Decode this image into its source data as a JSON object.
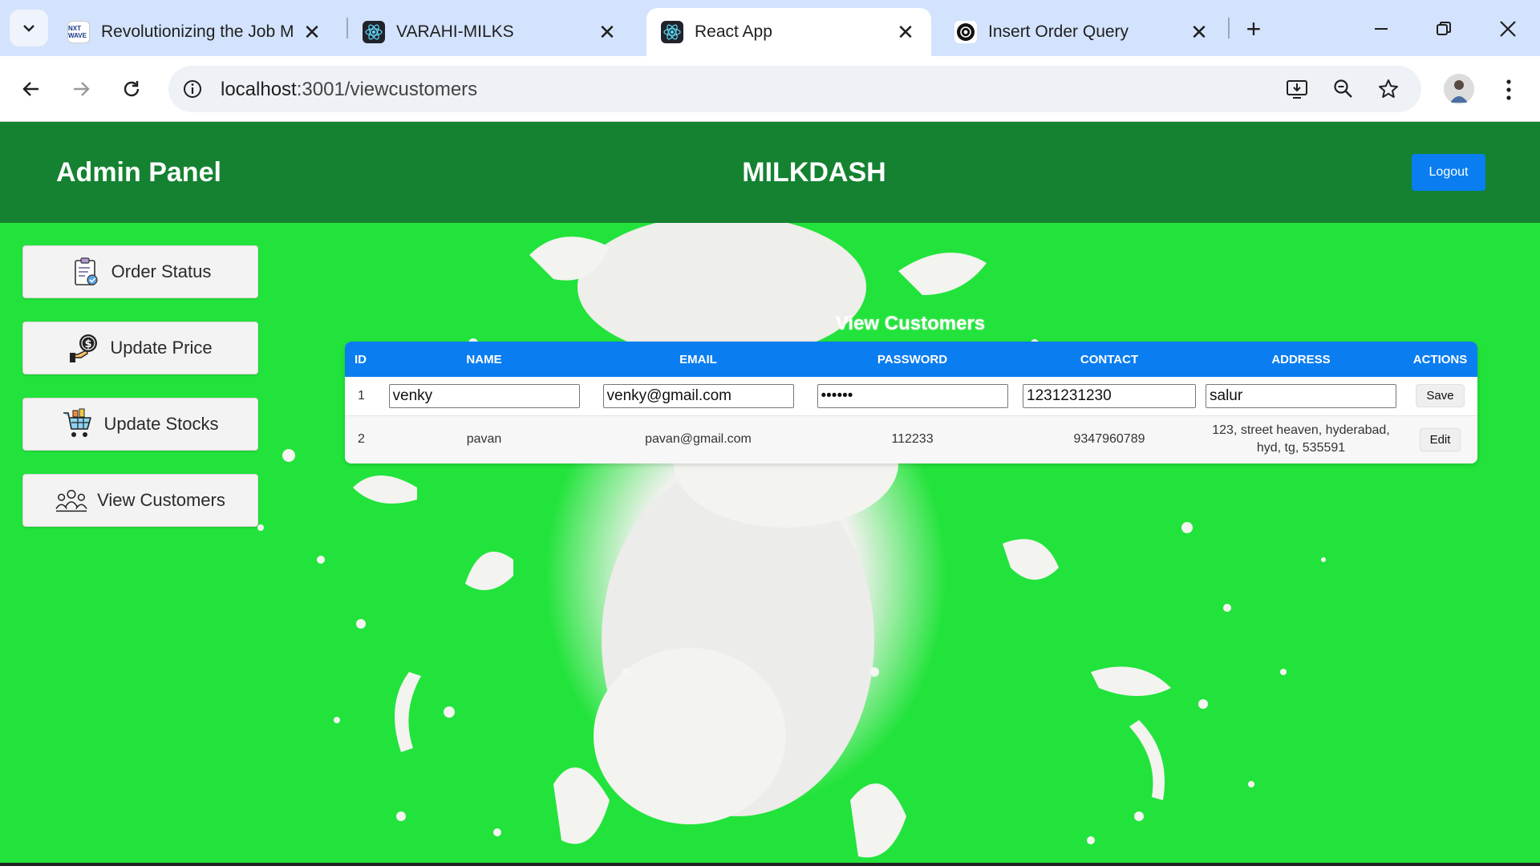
{
  "browser": {
    "tabs": [
      {
        "title": "Revolutionizing the Job M",
        "favicon": "nxtwave-favicon"
      },
      {
        "title": "VARAHI-MILKS",
        "favicon": "react-favicon"
      },
      {
        "title": "React App",
        "favicon": "react-favicon",
        "active": true
      },
      {
        "title": "Insert Order Query",
        "favicon": "chatgpt-favicon"
      }
    ],
    "favicon_text": "NXT WAVE",
    "url_host": "localhost",
    "url_path": ":3001/viewcustomers"
  },
  "header": {
    "admin_title": "Admin Panel",
    "brand": "MILKDASH",
    "logout_label": "Logout"
  },
  "sidebar": {
    "items": [
      {
        "label": "Order Status",
        "icon": "clipboard-icon"
      },
      {
        "label": "Update Price",
        "icon": "money-hand-icon"
      },
      {
        "label": "Update Stocks",
        "icon": "cart-icon"
      },
      {
        "label": "View Customers",
        "icon": "people-icon"
      }
    ]
  },
  "main": {
    "title": "View Customers",
    "columns": [
      "ID",
      "NAME",
      "EMAIL",
      "PASSWORD",
      "CONTACT",
      "ADDRESS",
      "ACTIONS"
    ],
    "editing_row": {
      "id": "1",
      "name": "venky",
      "email": "venky@gmail.com",
      "password": "••••••",
      "contact": "1231231230",
      "address": "salur",
      "action": "Save"
    },
    "rows": [
      {
        "id": "2",
        "name": "pavan",
        "email": "pavan@gmail.com",
        "password": "112233",
        "contact": "9347960789",
        "address_line1": "123, street heaven, hyderabad,",
        "address_line2": "hyd, tg, 535591",
        "action": "Edit"
      }
    ]
  },
  "colors": {
    "page_bg": "#22e33b",
    "header_bg": "#148231",
    "accent_blue": "#0a7df0"
  }
}
